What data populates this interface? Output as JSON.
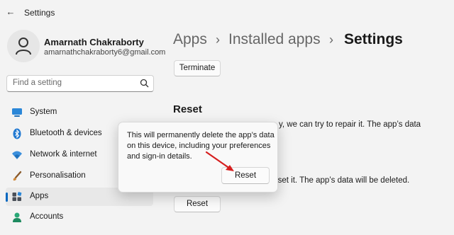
{
  "window": {
    "title": "Settings",
    "back_glyph": "←"
  },
  "user": {
    "name": "Amarnath Chakraborty",
    "email": "amarnathchakraborty6@gmail.com"
  },
  "search": {
    "placeholder": "Find a setting"
  },
  "nav": [
    {
      "label": "System",
      "icon": "monitor-icon"
    },
    {
      "label": "Bluetooth & devices",
      "icon": "bluetooth-icon"
    },
    {
      "label": "Network & internet",
      "icon": "wifi-icon"
    },
    {
      "label": "Personalisation",
      "icon": "brush-icon"
    },
    {
      "label": "Apps",
      "icon": "apps-icon",
      "selected": true
    },
    {
      "label": "Accounts",
      "icon": "person-icon"
    }
  ],
  "breadcrumb": {
    "items": [
      "Apps",
      "Installed apps",
      "Settings"
    ],
    "separator": "›"
  },
  "main": {
    "terminate_label": "Terminate",
    "reset_section_title": "Reset",
    "repair_text_visible": "y, we can try to repair it. The app’s data",
    "reset_text_visible": ", reset it. The app’s data will be deleted.",
    "reset_button_label": "Reset"
  },
  "flyout": {
    "lines": [
      "This will permanently delete the app’s data",
      "on this device, including your preferences",
      "and sign-in details."
    ],
    "confirm_label": "Reset"
  },
  "colors": {
    "accent": "#0067c0",
    "annotation_arrow": "#d61f1f"
  }
}
